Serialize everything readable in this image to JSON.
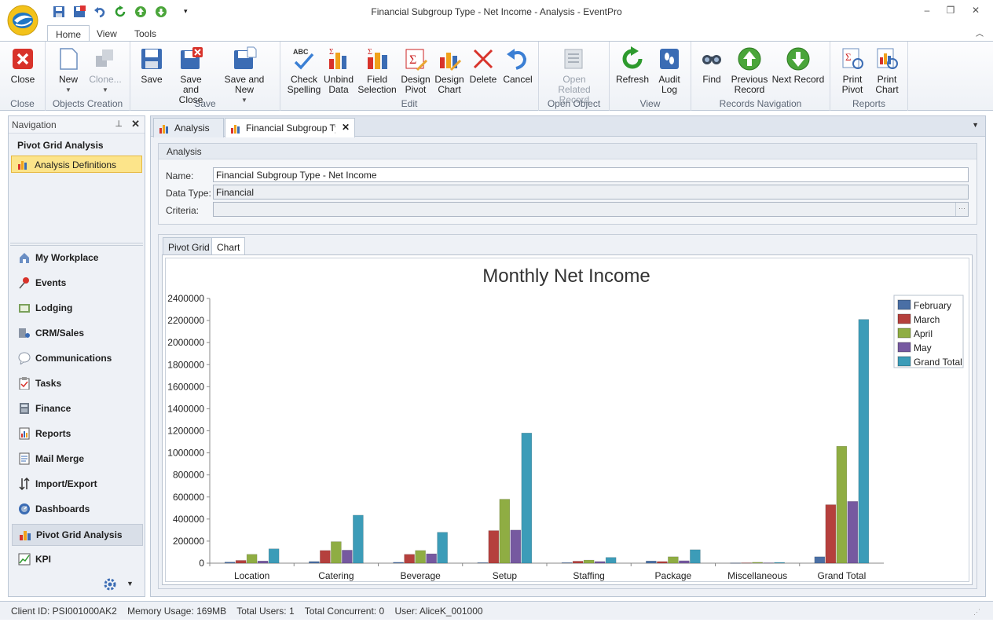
{
  "window": {
    "title": "Financial Subgroup Type - Net Income - Analysis - EventPro",
    "minimize": "–",
    "restore": "❐",
    "close": "✕"
  },
  "ribbon_tabs": [
    "Home",
    "View",
    "Tools"
  ],
  "ribbon": {
    "groups": [
      {
        "label": "Close",
        "buttons": [
          {
            "label": "Close",
            "icon": "close-icon"
          }
        ]
      },
      {
        "label": "Objects Creation",
        "buttons": [
          {
            "label": "New",
            "icon": "new-document-icon"
          },
          {
            "label": "Clone...",
            "icon": "clone-icon"
          }
        ]
      },
      {
        "label": "Save",
        "buttons": [
          {
            "label": "Save",
            "icon": "save-icon"
          },
          {
            "label": "Save and Close",
            "icon": "save-close-icon"
          },
          {
            "label": "Save and New",
            "icon": "save-new-icon"
          }
        ]
      },
      {
        "label": "Edit",
        "buttons": [
          {
            "label": "Check Spelling",
            "icon": "spellcheck-icon"
          },
          {
            "label": "Unbind Data",
            "icon": "unbind-data-icon"
          },
          {
            "label": "Field Selection",
            "icon": "field-selection-icon"
          },
          {
            "label": "Design Pivot",
            "icon": "design-pivot-icon"
          },
          {
            "label": "Design Chart",
            "icon": "design-chart-icon"
          },
          {
            "label": "Delete",
            "icon": "delete-icon"
          },
          {
            "label": "Cancel",
            "icon": "undo-icon"
          }
        ]
      },
      {
        "label": "Open Object",
        "buttons": [
          {
            "label": "Open Related Record",
            "icon": "open-related-icon"
          }
        ]
      },
      {
        "label": "View",
        "buttons": [
          {
            "label": "Refresh",
            "icon": "refresh-icon"
          },
          {
            "label": "Audit Log",
            "icon": "audit-log-icon"
          }
        ]
      },
      {
        "label": "Records Navigation",
        "buttons": [
          {
            "label": "Find",
            "icon": "binoculars-icon"
          },
          {
            "label": "Previous Record",
            "icon": "up-arrow-icon"
          },
          {
            "label": "Next Record",
            "icon": "down-arrow-icon"
          }
        ]
      },
      {
        "label": "Reports",
        "buttons": [
          {
            "label": "Print Pivot",
            "icon": "print-pivot-icon"
          },
          {
            "label": "Print Chart",
            "icon": "print-chart-icon"
          }
        ]
      }
    ]
  },
  "navigation": {
    "header": "Navigation",
    "group_title": "Pivot Grid Analysis",
    "active_item": "Analysis Definitions",
    "modules": [
      "My Workplace",
      "Events",
      "Lodging",
      "CRM/Sales",
      "Communications",
      "Tasks",
      "Finance",
      "Reports",
      "Mail Merge",
      "Import/Export",
      "Dashboards",
      "Pivot Grid Analysis",
      "KPI"
    ],
    "selected_module": "Pivot Grid Analysis"
  },
  "doc_tabs": [
    "Analysis",
    "Financial Subgroup Type"
  ],
  "analysis": {
    "group_title": "Analysis",
    "name_label": "Name:",
    "name_value": "Financial Subgroup Type - Net Income",
    "datatype_label": "Data Type:",
    "datatype_value": "Financial",
    "criteria_label": "Criteria:",
    "criteria_value": "",
    "criteria_button": "···"
  },
  "inner_tabs": [
    "Pivot Grid",
    "Chart"
  ],
  "colors": {
    "February": "#4a6fa5",
    "March": "#b5403d",
    "April": "#8fad43",
    "May": "#7659a0",
    "Grand Total": "#3c9cb8"
  },
  "chart_data": {
    "type": "bar",
    "title": "Monthly Net Income",
    "categories": [
      "Location",
      "Catering",
      "Beverage",
      "Setup",
      "Staffing",
      "Package",
      "Miscellaneous",
      "Grand Total"
    ],
    "series": [
      {
        "name": "February",
        "values": [
          10000,
          15000,
          8000,
          5000,
          5000,
          20000,
          2000,
          58000
        ]
      },
      {
        "name": "March",
        "values": [
          25000,
          115000,
          80000,
          295000,
          18000,
          15000,
          3000,
          530000
        ]
      },
      {
        "name": "April",
        "values": [
          80000,
          195000,
          115000,
          580000,
          28000,
          58000,
          8000,
          1060000
        ]
      },
      {
        "name": "May",
        "values": [
          20000,
          118000,
          85000,
          300000,
          15000,
          22000,
          3000,
          560000
        ]
      },
      {
        "name": "Grand Total",
        "values": [
          130000,
          435000,
          280000,
          1180000,
          52000,
          122000,
          7000,
          2210000
        ]
      }
    ],
    "ylim": [
      0,
      2400000
    ],
    "y_ticks": [
      "0",
      "200000",
      "400000",
      "600000",
      "800000",
      "1000000",
      "1200000",
      "1400000",
      "1600000",
      "1800000",
      "2000000",
      "2200000",
      "2400000"
    ],
    "legend_position": "top-right",
    "grid": false
  },
  "statusbar": {
    "client_id": "Client ID: PSI001000AK2",
    "memory": "Memory Usage: 169MB",
    "total_users": "Total Users: 1",
    "total_concurrent": "Total Concurrent: 0",
    "user": "User: AliceK_001000"
  }
}
